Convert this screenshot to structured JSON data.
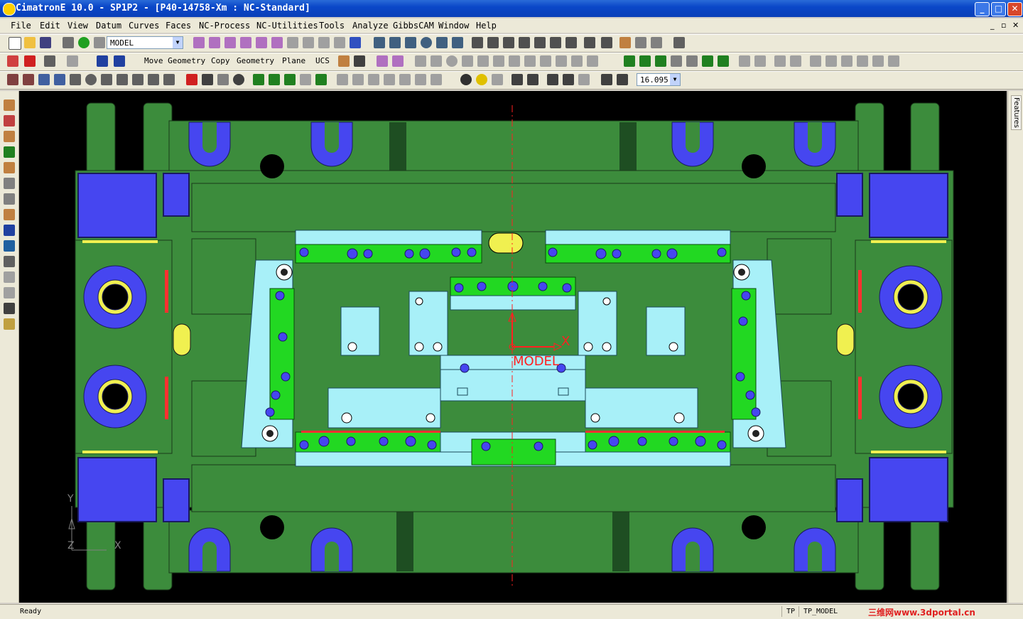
{
  "window": {
    "title": "CimatronE 10.0 - SP1P2 - [P40-14758-Xm : NC-Standard]",
    "controls": [
      "_",
      "□",
      "✕"
    ]
  },
  "menu": {
    "items": [
      "File",
      "Edit",
      "View",
      "Datum",
      "Curves",
      "Faces",
      "NC-Process",
      "NC-Utilities",
      "Tools",
      "Analyze",
      "GibbsCAM",
      "Window",
      "Help"
    ],
    "doc_controls": [
      "_",
      "▫",
      "✕"
    ]
  },
  "toolbar1": {
    "model_combo": "MODEL"
  },
  "toolbar2": {
    "move_geometry": "Move Geometry",
    "copy": "Copy",
    "geometry": "Geometry",
    "plane": "Plane",
    "ucs": "UCS"
  },
  "toolbar3": {
    "zoom_value": "16.095"
  },
  "viewport": {
    "axis_label": "X",
    "ucs_label": "MODEL",
    "triad": {
      "x": "X",
      "y": "Y",
      "z": "Z"
    }
  },
  "right_panel": {
    "features_tab": "Features"
  },
  "status": {
    "ready": "Ready",
    "tp": "TP",
    "tp_model": "TP_MODEL",
    "watermark": "三维网www.3dportal.cn"
  },
  "colors": {
    "mold_green": "#3c8c3c",
    "bright_green": "#22d822",
    "cyan": "#a8f0f8",
    "blue": "#4646f0",
    "yellow": "#f0f050",
    "red": "#ff2020"
  }
}
